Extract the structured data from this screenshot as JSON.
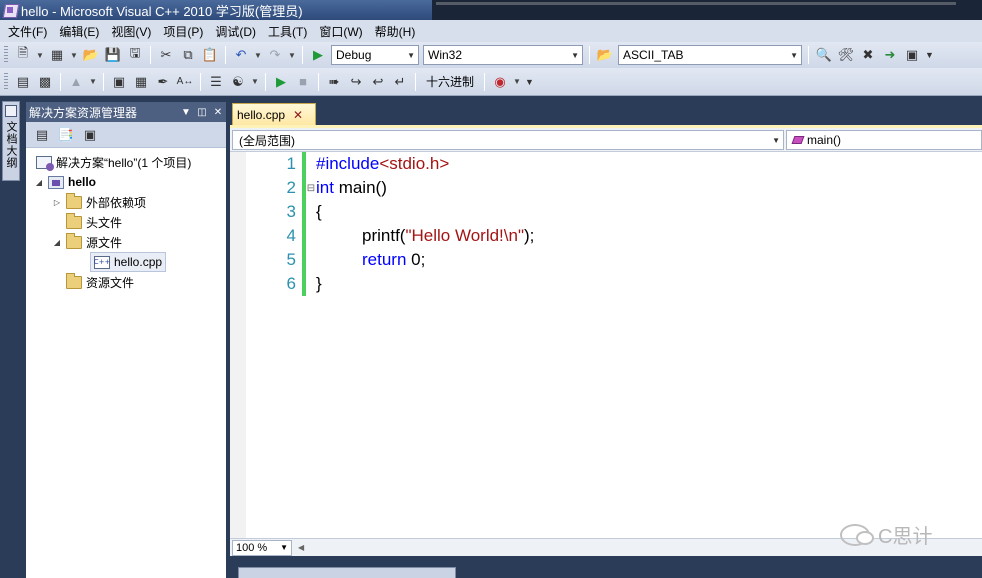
{
  "window": {
    "title": "hello - Microsoft Visual C++ 2010 学习版(管理员)"
  },
  "menu": [
    "文件(F)",
    "编辑(E)",
    "视图(V)",
    "项目(P)",
    "调试(D)",
    "工具(T)",
    "窗口(W)",
    "帮助(H)"
  ],
  "toolbar": {
    "config": "Debug",
    "platform": "Win32",
    "search_combo": "ASCII_TAB",
    "hex_label": "十六进制"
  },
  "left_strip": {
    "tab_label": "文档大纲"
  },
  "solution_explorer": {
    "title": "解决方案资源管理器",
    "tree": [
      {
        "label": "解决方案“hello”(1 个项目)",
        "icon": "solution-icon"
      },
      {
        "label": "hello",
        "icon": "project-icon",
        "expanded": true
      },
      {
        "label": "外部依赖项",
        "icon": "folder-icon",
        "expanded": false
      },
      {
        "label": "头文件",
        "icon": "folder-icon"
      },
      {
        "label": "源文件",
        "icon": "folder-open-icon",
        "expanded": true
      },
      {
        "label": "hello.cpp",
        "icon": "cpp-file-icon",
        "selected": true
      },
      {
        "label": "资源文件",
        "icon": "folder-icon"
      }
    ]
  },
  "editor": {
    "tab_label": "hello.cpp",
    "scope": "(全局范围)",
    "member": "main()",
    "zoom": "100 %",
    "lines": [
      {
        "num": "1",
        "parts": [
          {
            "t": "#include",
            "c": "kw"
          },
          {
            "t": "<stdio.h>",
            "c": "str"
          }
        ]
      },
      {
        "num": "2",
        "parts": [
          {
            "t": "int",
            "c": "kw"
          },
          {
            "t": " main()",
            "c": "plain"
          }
        ]
      },
      {
        "num": "3",
        "parts": [
          {
            "t": "{",
            "c": "plain"
          }
        ]
      },
      {
        "num": "4",
        "parts": [
          {
            "t": "printf(",
            "c": "plain"
          },
          {
            "t": "\"Hello World!\\n\"",
            "c": "str"
          },
          {
            "t": ");",
            "c": "plain"
          }
        ]
      },
      {
        "num": "5",
        "parts": [
          {
            "t": "return",
            "c": "kw"
          },
          {
            "t": " 0;",
            "c": "plain"
          }
        ]
      },
      {
        "num": "6",
        "parts": [
          {
            "t": "}",
            "c": "plain"
          }
        ]
      }
    ]
  },
  "watermark": "C思计",
  "colors": {
    "chrome_dark": "#2b3c59",
    "keyword": "#0000ff",
    "string": "#a31515",
    "line_number": "#2b91af",
    "change_bar": "#4bcf5d"
  }
}
